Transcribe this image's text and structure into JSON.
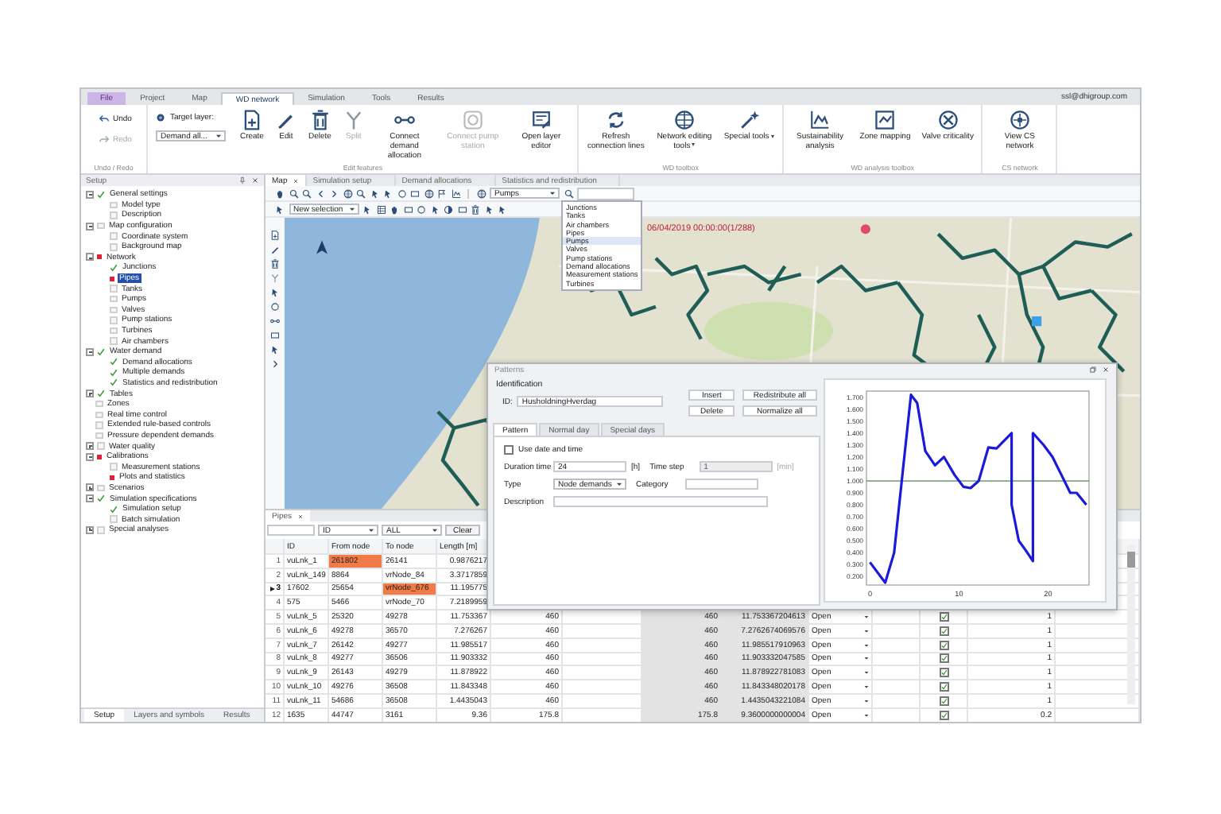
{
  "window": {
    "account": "ssl@dhigroup.com"
  },
  "menu_tabs": [
    {
      "label": "File",
      "kind": "file",
      "selected": false
    },
    {
      "label": "Project",
      "kind": "tab",
      "selected": false
    },
    {
      "label": "Map",
      "kind": "tab",
      "selected": false
    },
    {
      "label": "WD network",
      "kind": "tab",
      "selected": true
    },
    {
      "label": "Simulation",
      "kind": "tab",
      "selected": false
    },
    {
      "label": "Tools",
      "kind": "tab",
      "selected": false
    },
    {
      "label": "Results",
      "kind": "tab",
      "selected": false
    }
  ],
  "ribbon": {
    "groups": [
      {
        "label": "Undo / Redo",
        "items": [
          {
            "kind": "small",
            "label": "Undo",
            "disabled": false
          },
          {
            "kind": "small",
            "label": "Redo",
            "disabled": true
          }
        ]
      },
      {
        "label": "Edit features",
        "items": [
          {
            "kind": "target",
            "label": "Target layer:",
            "value": "Demand all..."
          },
          {
            "kind": "large",
            "label": "Create",
            "disabled": false,
            "menu": false
          },
          {
            "kind": "large",
            "label": "Edit",
            "disabled": false,
            "menu": false
          },
          {
            "kind": "large",
            "label": "Delete",
            "disabled": false,
            "menu": false
          },
          {
            "kind": "large",
            "label": "Split",
            "disabled": true,
            "menu": false
          },
          {
            "kind": "large",
            "label": "Connect demand allocation",
            "disabled": false,
            "menu": false
          },
          {
            "kind": "large",
            "label": "Connect pump station",
            "disabled": true,
            "menu": false
          },
          {
            "kind": "large",
            "label": "Open layer editor",
            "disabled": false,
            "menu": false
          }
        ]
      },
      {
        "label": "WD toolbox",
        "items": [
          {
            "kind": "large",
            "label": "Refresh connection lines",
            "disabled": false,
            "menu": false
          },
          {
            "kind": "large",
            "label": "Network editing tools",
            "disabled": false,
            "menu": true
          },
          {
            "kind": "large",
            "label": "Special tools",
            "disabled": false,
            "menu": true
          }
        ]
      },
      {
        "label": "WD analysis toolbox",
        "items": [
          {
            "kind": "large",
            "label": "Sustainability analysis",
            "disabled": false,
            "menu": false
          },
          {
            "kind": "large",
            "label": "Zone mapping",
            "disabled": false,
            "menu": false
          },
          {
            "kind": "large",
            "label": "Valve criticality",
            "disabled": false,
            "menu": false
          }
        ]
      },
      {
        "label": "CS network",
        "items": [
          {
            "kind": "large",
            "label": "View CS network",
            "disabled": false,
            "menu": false
          }
        ]
      }
    ]
  },
  "setup_panel": {
    "title": "Setup",
    "tree": [
      {
        "label": "General settings",
        "done": true,
        "error": false,
        "selected": false,
        "expanded": true,
        "children": [
          {
            "label": "Model type",
            "done": false,
            "error": false,
            "selected": false
          },
          {
            "label": "Description",
            "done": false,
            "error": false,
            "selected": false
          }
        ]
      },
      {
        "label": "Map configuration",
        "done": false,
        "error": false,
        "selected": false,
        "expanded": true,
        "children": [
          {
            "label": "Coordinate system",
            "done": false,
            "error": false,
            "selected": false
          },
          {
            "label": "Background map",
            "done": false,
            "error": false,
            "selected": false
          }
        ]
      },
      {
        "label": "Network",
        "done": false,
        "error": true,
        "selected": false,
        "expanded": true,
        "children": [
          {
            "label": "Junctions",
            "done": true,
            "error": false,
            "selected": false
          },
          {
            "label": "Pipes",
            "done": false,
            "error": true,
            "selected": true
          },
          {
            "label": "Tanks",
            "done": false,
            "error": false,
            "selected": false
          },
          {
            "label": "Pumps",
            "done": false,
            "error": false,
            "selected": false
          },
          {
            "label": "Valves",
            "done": false,
            "error": false,
            "selected": false
          },
          {
            "label": "Pump stations",
            "done": false,
            "error": false,
            "selected": false
          },
          {
            "label": "Turbines",
            "done": false,
            "error": false,
            "selected": false
          },
          {
            "label": "Air chambers",
            "done": false,
            "error": false,
            "selected": false
          }
        ]
      },
      {
        "label": "Water demand",
        "done": true,
        "error": false,
        "selected": false,
        "expanded": true,
        "children": [
          {
            "label": "Demand allocations",
            "done": true,
            "error": false,
            "selected": false
          },
          {
            "label": "Multiple demands",
            "done": true,
            "error": false,
            "selected": false
          },
          {
            "label": "Statistics and redistribution",
            "done": true,
            "error": false,
            "selected": false
          }
        ]
      },
      {
        "label": "Tables",
        "done": true,
        "error": false,
        "selected": false,
        "expanded": false
      },
      {
        "label": "Zones",
        "done": false,
        "error": false,
        "selected": false
      },
      {
        "label": "Real time control",
        "done": false,
        "error": false,
        "selected": false
      },
      {
        "label": "Extended rule-based controls",
        "done": false,
        "error": false,
        "selected": false
      },
      {
        "label": "Pressure dependent demands",
        "done": false,
        "error": false,
        "selected": false
      },
      {
        "label": "Water quality",
        "done": false,
        "error": false,
        "selected": false,
        "expanded": false
      },
      {
        "label": "Calibrations",
        "done": false,
        "error": true,
        "selected": false,
        "expanded": true,
        "children": [
          {
            "label": "Measurement stations",
            "done": false,
            "error": false,
            "selected": false
          },
          {
            "label": "Plots and statistics",
            "done": false,
            "error": true,
            "selected": false
          }
        ]
      },
      {
        "label": "Scenarios",
        "done": false,
        "error": false,
        "selected": false,
        "expanded": false
      },
      {
        "label": "Simulation specifications",
        "done": true,
        "error": false,
        "selected": false,
        "expanded": true,
        "children": [
          {
            "label": "Simulation setup",
            "done": true,
            "error": false,
            "selected": false
          },
          {
            "label": "Batch simulation",
            "done": false,
            "error": false,
            "selected": false
          }
        ]
      },
      {
        "label": "Special analyses",
        "done": false,
        "error": false,
        "selected": false,
        "expanded": false
      }
    ],
    "bottom_tabs": [
      {
        "label": "Setup",
        "selected": true
      },
      {
        "label": "Layers and symbols",
        "selected": false
      },
      {
        "label": "Results",
        "selected": false
      }
    ]
  },
  "doc_tabs": [
    {
      "label": "Map",
      "selected": true,
      "closable": true
    },
    {
      "label": "Simulation setup",
      "selected": false,
      "closable": false
    },
    {
      "label": "Demand allocations",
      "selected": false,
      "closable": false
    },
    {
      "label": "Statistics and redistribution",
      "selected": false,
      "closable": false
    }
  ],
  "map_toolbar": {
    "layer": "Pumps",
    "selection_mode": "New selection"
  },
  "layer_menu": [
    {
      "label": "Junctions",
      "selected": false
    },
    {
      "label": "Tanks",
      "selected": false
    },
    {
      "label": "Air chambers",
      "selected": false
    },
    {
      "label": "Pipes",
      "selected": false
    },
    {
      "label": "Pumps",
      "selected": true
    },
    {
      "label": "Valves",
      "selected": false
    },
    {
      "label": "Pump stations",
      "selected": false
    },
    {
      "label": "Demand allocations",
      "selected": false
    },
    {
      "label": "Measurement stations",
      "selected": false
    },
    {
      "label": "Turbines",
      "selected": false
    }
  ],
  "map": {
    "timestamp": "06/04/2019 00:00:00(1/288)"
  },
  "pipes_panel": {
    "tab": "Pipes",
    "filter": {
      "column": "ID",
      "value": "ALL",
      "button": "Clear"
    },
    "columns": [
      "ID",
      "From node",
      "To node",
      "Length [m]"
    ],
    "rows": [
      {
        "number": "1",
        "current": false,
        "id": "vuLnk_1",
        "from_node": "261802",
        "from_flagged": true,
        "to_node": "26141",
        "to_flagged": false,
        "length": "0.9876217"
      },
      {
        "number": "2",
        "current": false,
        "id": "vuLnk_149",
        "from_node": "8864",
        "from_flagged": false,
        "to_node": "vrNode_84",
        "to_flagged": false,
        "length": "3.3717859"
      },
      {
        "number": "3",
        "current": true,
        "id": "17602",
        "from_node": "25654",
        "from_flagged": false,
        "to_node": "vrNode_676",
        "to_flagged": true,
        "length": "11.195775"
      },
      {
        "number": "4",
        "current": false,
        "id": "575",
        "from_node": "5466",
        "from_flagged": false,
        "to_node": "vrNode_70",
        "to_flagged": false,
        "length": "7.2189959"
      },
      {
        "number": "5",
        "current": false,
        "id": "vuLnk_5",
        "from_node": "25320",
        "from_flagged": false,
        "to_node": "49278",
        "to_flagged": false,
        "length": "11.753367",
        "column_5": "460",
        "column_7": "460",
        "column_8": "11.753367204613",
        "column_9": "Open",
        "column_11": true,
        "column_12": "1"
      },
      {
        "number": "6",
        "current": false,
        "id": "vuLnk_6",
        "from_node": "49278",
        "from_flagged": false,
        "to_node": "36570",
        "to_flagged": false,
        "length": "7.276267",
        "column_5": "460",
        "column_7": "460",
        "column_8": "7.2762674069576",
        "column_9": "Open",
        "column_11": true,
        "column_12": "1"
      },
      {
        "number": "7",
        "current": false,
        "id": "vuLnk_7",
        "from_node": "26142",
        "from_flagged": false,
        "to_node": "49277",
        "to_flagged": false,
        "length": "11.985517",
        "column_5": "460",
        "column_7": "460",
        "column_8": "11.985517910963",
        "column_9": "Open",
        "column_11": true,
        "column_12": "1"
      },
      {
        "number": "8",
        "current": false,
        "id": "vuLnk_8",
        "from_node": "49277",
        "from_flagged": false,
        "to_node": "36506",
        "to_flagged": false,
        "length": "11.903332",
        "column_5": "460",
        "column_7": "460",
        "column_8": "11.903332047585",
        "column_9": "Open",
        "column_11": true,
        "column_12": "1"
      },
      {
        "number": "9",
        "current": false,
        "id": "vuLnk_9",
        "from_node": "26143",
        "from_flagged": false,
        "to_node": "49279",
        "to_flagged": false,
        "length": "11.878922",
        "column_5": "460",
        "column_7": "460",
        "column_8": "11.878922781083",
        "column_9": "Open",
        "column_11": true,
        "column_12": "1"
      },
      {
        "number": "10",
        "current": false,
        "id": "vuLnk_10",
        "from_node": "49276",
        "from_flagged": false,
        "to_node": "36508",
        "to_flagged": false,
        "length": "11.843348",
        "column_5": "460",
        "column_7": "460",
        "column_8": "11.843348020178",
        "column_9": "Open",
        "column_11": true,
        "column_12": "1"
      },
      {
        "number": "11",
        "current": false,
        "id": "vuLnk_11",
        "from_node": "54686",
        "from_flagged": false,
        "to_node": "36508",
        "to_flagged": false,
        "length": "1.4435043",
        "column_5": "460",
        "column_7": "460",
        "column_8": "1.4435043221084",
        "column_9": "Open",
        "column_11": true,
        "column_12": "1"
      },
      {
        "number": "12",
        "current": false,
        "id": "1635",
        "from_node": "44747",
        "from_flagged": false,
        "to_node": "3161",
        "to_flagged": false,
        "length": "9.36",
        "column_5": "175.8",
        "column_7": "175.8",
        "column_8": "9.3600000000004",
        "column_9": "Open",
        "column_11": true,
        "column_12": "0.2"
      }
    ]
  },
  "dialog": {
    "title": "Patterns",
    "section": "Identification",
    "id_label": "ID:",
    "id_value": "HusholdningHverdag",
    "buttons": [
      "Insert",
      "Redistribute all",
      "Delete",
      "Normalize all"
    ],
    "tabs": [
      {
        "label": "Pattern",
        "selected": true
      },
      {
        "label": "Normal day",
        "selected": false
      },
      {
        "label": "Special days",
        "selected": false
      }
    ],
    "use_date_time": {
      "label": "Use date and time",
      "checked": false
    },
    "field_rows": [
      [
        {
          "label": "Duration time",
          "kind": "text",
          "value": "24",
          "unit": "[h]",
          "disabled": false
        },
        {
          "label": "Time step",
          "kind": "text",
          "value": "1",
          "unit": "[min]",
          "disabled": true
        }
      ],
      [
        {
          "label": "Type",
          "kind": "select",
          "value": "Node demands",
          "disabled": false
        },
        {
          "label": "Category",
          "kind": "text",
          "disabled": false
        }
      ],
      [
        {
          "label": "Description",
          "kind": "wide",
          "disabled": false
        }
      ]
    ],
    "chart_data": {
      "type": "line",
      "x": [
        0,
        1.7,
        2.7,
        3.5,
        4.6,
        5.3,
        6.2,
        7.3,
        8.3,
        9.5,
        10.5,
        11.3,
        12.2,
        13.3,
        14.2,
        15.9,
        15.9,
        16.7,
        17.5,
        18.3,
        18.3,
        19.5,
        20.5,
        21.5,
        22.5,
        23.2,
        24.3
      ],
      "series": [
        {
          "color": "#1a1ad8",
          "values": [
            0.32,
            0.15,
            0.4,
            0.95,
            1.72,
            1.65,
            1.25,
            1.13,
            1.2,
            1.05,
            0.95,
            0.94,
            1.0,
            1.28,
            1.27,
            1.4,
            0.8,
            0.5,
            0.42,
            0.33,
            1.4,
            1.3,
            1.2,
            1.05,
            0.9,
            0.9,
            0.8
          ]
        }
      ],
      "xlim": [
        -0.4,
        24.6
      ],
      "ylim": [
        0.13,
        1.75
      ],
      "xticks": [
        0,
        10,
        20
      ],
      "yticks": [
        {
          "value": 0.2,
          "label": "0.200"
        },
        {
          "value": 0.3,
          "label": "0.300"
        },
        {
          "value": 0.4,
          "label": "0.400"
        },
        {
          "value": 0.5,
          "label": "0.500"
        },
        {
          "value": 0.6,
          "label": "0.600"
        },
        {
          "value": 0.7,
          "label": "0.700"
        },
        {
          "value": 0.8,
          "label": "0.800"
        },
        {
          "value": 0.9,
          "label": "0.900"
        },
        {
          "value": 1.0,
          "label": "1.000"
        },
        {
          "value": 1.1,
          "label": "1.100"
        },
        {
          "value": 1.2,
          "label": "1.200"
        },
        {
          "value": 1.3,
          "label": "1.300"
        },
        {
          "value": 1.4,
          "label": "1.400"
        },
        {
          "value": 1.5,
          "label": "1.500"
        },
        {
          "value": 1.6,
          "label": "1.600"
        },
        {
          "value": 1.7,
          "label": "1.700"
        }
      ],
      "ref_lines": [
        {
          "axis": "y",
          "value": 1.0
        }
      ]
    }
  }
}
